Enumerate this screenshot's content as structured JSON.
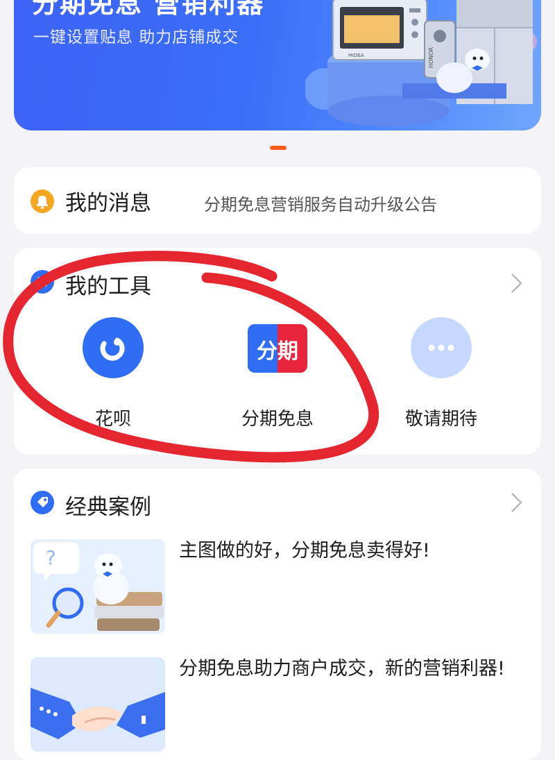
{
  "banner": {
    "title": "分期免息 营销利器",
    "subtitle": "一键设置贴息 助力店铺成交",
    "oven_brand": "MIDEA",
    "phone_brand": "HONOR"
  },
  "messages": {
    "title": "我的消息",
    "notice": "分期免息营销服务自动升级公告"
  },
  "tools": {
    "title": "我的工具",
    "items": [
      {
        "label": "花呗",
        "icon": "huabei-icon"
      },
      {
        "label": "分期免息",
        "icon": "fenqi-icon",
        "icon_text": "分期"
      },
      {
        "label": "敬请期待",
        "icon": "more-icon"
      }
    ]
  },
  "cases": {
    "title": "经典案例",
    "items": [
      {
        "title": "主图做的好，分期免息卖得好!"
      },
      {
        "title": "分期免息助力商户成交，新的营销利器!"
      }
    ]
  },
  "colors": {
    "accent_blue": "#2f6df5",
    "indicator_orange": "#ff5a1f",
    "bell_yellow": "#f5a623",
    "annotation_red": "#e5252f"
  }
}
